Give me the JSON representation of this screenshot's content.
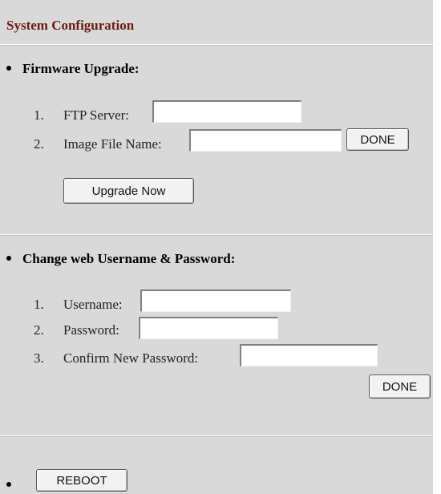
{
  "header": {
    "title": "System Configuration"
  },
  "firmware": {
    "heading": "Firmware Upgrade:",
    "ftp_server": {
      "number": "1.",
      "label": "FTP Server:",
      "value": ""
    },
    "image_file": {
      "number": "2.",
      "label": "Image File Name:",
      "value": ""
    },
    "done_label": "DONE",
    "upgrade_label": "Upgrade Now"
  },
  "credentials": {
    "heading": "Change web Username & Password:",
    "username": {
      "number": "1.",
      "label": "Username:",
      "value": ""
    },
    "password": {
      "number": "2.",
      "label": "Password:",
      "value": ""
    },
    "confirm": {
      "number": "3.",
      "label": "Confirm New Password:",
      "value": ""
    },
    "done_label": "DONE"
  },
  "reboot": {
    "label": "REBOOT"
  }
}
